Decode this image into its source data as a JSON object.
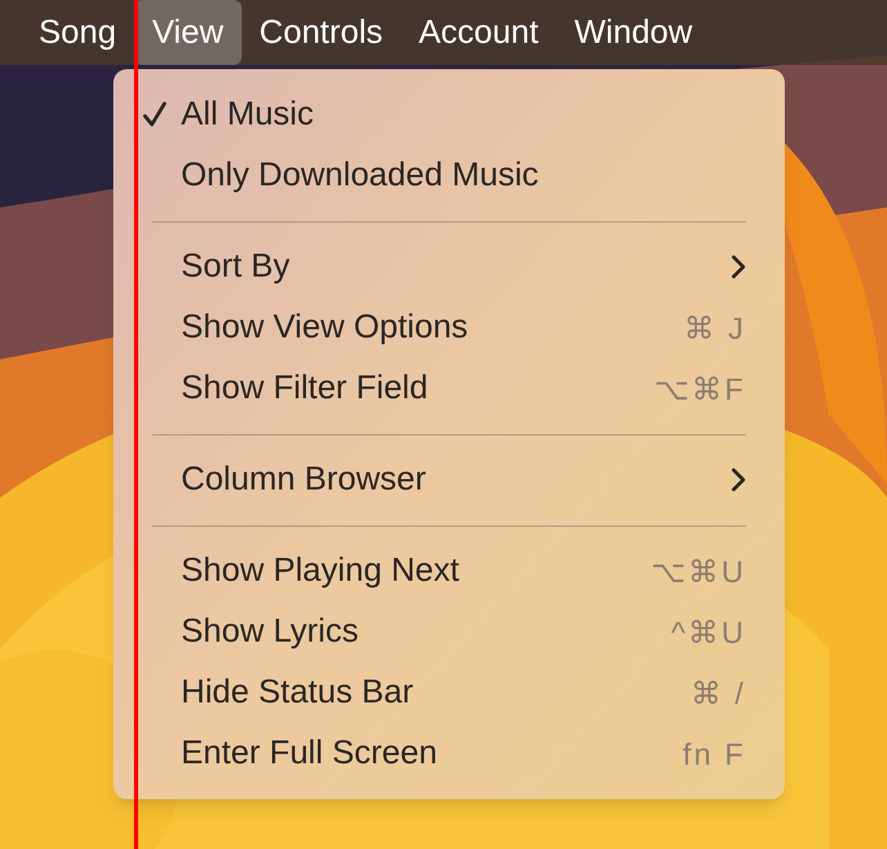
{
  "menu_bar": {
    "items": [
      {
        "label": "Song",
        "selected": false
      },
      {
        "label": "View",
        "selected": true
      },
      {
        "label": "Controls",
        "selected": false
      },
      {
        "label": "Account",
        "selected": false
      },
      {
        "label": "Window",
        "selected": false
      }
    ]
  },
  "menu": {
    "items": [
      {
        "kind": "item",
        "label": "All Music",
        "checked": true,
        "submenu": false
      },
      {
        "kind": "item",
        "label": "Only Downloaded Music",
        "checked": false,
        "submenu": false
      },
      {
        "kind": "separator"
      },
      {
        "kind": "item",
        "label": "Sort By",
        "checked": false,
        "submenu": true
      },
      {
        "kind": "item",
        "label": "Show View Options",
        "checked": false,
        "submenu": false,
        "shortcut": "⌘ J"
      },
      {
        "kind": "item",
        "label": "Show Filter Field",
        "checked": false,
        "submenu": false,
        "shortcut": "⌥⌘F"
      },
      {
        "kind": "separator"
      },
      {
        "kind": "item",
        "label": "Column Browser",
        "checked": false,
        "submenu": true
      },
      {
        "kind": "separator"
      },
      {
        "kind": "item",
        "label": "Show Playing Next",
        "checked": false,
        "submenu": false,
        "shortcut": "⌥⌘U"
      },
      {
        "kind": "item",
        "label": "Show Lyrics",
        "checked": false,
        "submenu": false,
        "shortcut": "^⌘U"
      },
      {
        "kind": "item",
        "label": "Hide Status Bar",
        "checked": false,
        "submenu": false,
        "shortcut": "⌘ /"
      },
      {
        "kind": "item",
        "label": "Enter Full Screen",
        "checked": false,
        "submenu": false,
        "shortcut": "fn F"
      }
    ]
  }
}
